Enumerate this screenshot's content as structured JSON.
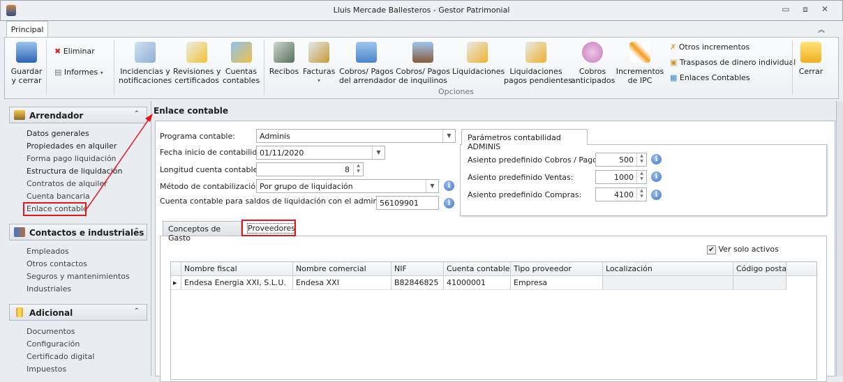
{
  "window": {
    "title": "Lluis Mercade Ballesteros - Gestor Patrimonial",
    "minimize": "▭",
    "restore": "⧈",
    "close": "✕",
    "collapse": "︽"
  },
  "ribbon": {
    "tab": "Principal",
    "group_label": "Opciones",
    "buttons": {
      "guardar": "Guardar\ny cerrar",
      "eliminar": "Eliminar",
      "informes": "Informes",
      "incidencias": "Incidencias y\nnotificaciones",
      "revisiones": "Revisiones y\ncertificados",
      "cuentas": "Cuentas\ncontables",
      "recibos": "Recibos",
      "facturas": "Facturas",
      "cobros_arr": "Cobros/ Pagos\ndel arrendador",
      "cobros_inq": "Cobros/ Pagos\nde inquilinos",
      "liquidaciones": "Liquidaciones",
      "liq_pend": "Liquidaciones\npagos pendientes",
      "cobros_ant": "Cobros\nanticipados",
      "incrementos": "Incrementos\nde IPC",
      "otros": "Otros incrementos",
      "traspasos": "Traspasos de dinero individual",
      "enlaces": "Enlaces Contables",
      "cerrar": "Cerrar"
    }
  },
  "sidebar": {
    "groups": [
      {
        "title": "Arrendador",
        "items": [
          "Datos generales",
          "Propiedades en alquiler",
          "Forma pago liquidación",
          "Estructura de liquidación",
          "Contratos de alquiler",
          "Cuenta bancaria",
          "Enlace contable"
        ]
      },
      {
        "title": "Contactos e industriales",
        "items": [
          "Empleados",
          "Otros contactos",
          "Seguros y mantenimientos",
          "Industriales"
        ]
      },
      {
        "title": "Adicional",
        "items": [
          "Documentos",
          "Configuración",
          "Certificado digital",
          "Impuestos"
        ]
      }
    ]
  },
  "panel": {
    "title": "Enlace contable",
    "form": {
      "programa_label": "Programa contable:",
      "programa": "Adminis",
      "fecha_label": "Fecha inicio de contabilidad:",
      "fecha": "01/11/2020",
      "longitud_label": "Longitud cuenta contable:",
      "longitud": "8",
      "metodo_label": "Método de contabilización:",
      "metodo": "Por grupo de liquidación",
      "cuenta_label": "Cuenta contable para saldos de liquidación con el administrador",
      "cuenta": "56109901"
    },
    "params": {
      "tab": "Parámetros contabilidad ADMINIS",
      "cobros_label": "Asiento  predefinido Cobros / Pagos:",
      "cobros": "500",
      "ventas_label": "Asiento  predefinido Ventas:",
      "ventas": "1000",
      "compras_label": "Asiento predefinido Compras:",
      "compras": "4100"
    },
    "tabs": [
      "Conceptos de Gasto",
      "Proveedores"
    ],
    "solo_activos": "Ver solo activos",
    "table": {
      "columns": [
        "Nombre fiscal",
        "Nombre comercial",
        "NIF",
        "Cuenta contable",
        "Tipo proveedor",
        "Localización",
        "Código postal"
      ],
      "rows": [
        [
          "Endesa Energia XXI, S.L.U.",
          "Endesa XXI",
          "B82846825",
          "41000001",
          "Empresa",
          "",
          ""
        ]
      ]
    }
  }
}
